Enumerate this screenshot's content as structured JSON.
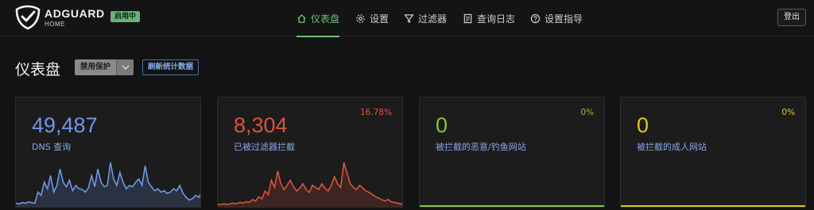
{
  "header": {
    "brand": "ADGUARD",
    "brand_sub": "HOME",
    "status_badge": "启用中",
    "nav": [
      {
        "label": "仪表盘",
        "icon": "home-icon"
      },
      {
        "label": "设置",
        "icon": "gear-icon"
      },
      {
        "label": "过滤器",
        "icon": "filter-icon"
      },
      {
        "label": "查询日志",
        "icon": "document-icon"
      },
      {
        "label": "设置指导",
        "icon": "help-circle-icon"
      }
    ],
    "logout": "登出"
  },
  "page": {
    "title": "仪表盘",
    "disable_protection": "禁用保护",
    "refresh_stats": "刷新统计数据"
  },
  "cards": [
    {
      "value": "49,487",
      "label": "DNS 查询",
      "percent": "",
      "color": "#6e96e8",
      "sparkline": [
        3,
        2,
        4,
        3,
        5,
        4,
        3,
        20,
        15,
        35,
        25,
        45,
        20,
        30,
        55,
        35,
        28,
        38,
        22,
        30,
        25,
        24,
        20,
        26,
        45,
        28,
        55,
        35,
        28,
        30,
        65,
        40,
        30,
        50,
        35,
        25,
        30,
        28,
        35,
        40,
        30,
        60,
        35,
        28,
        22,
        25,
        20,
        22,
        18,
        20,
        25,
        22,
        30,
        18,
        12,
        8,
        10,
        15,
        12,
        20
      ]
    },
    {
      "value": "8,304",
      "label": "已被过滤器拦截",
      "percent": "16.78%",
      "color": "#d9533e",
      "sparkline": [
        1,
        1,
        2,
        1,
        2,
        3,
        2,
        4,
        3,
        5,
        4,
        8,
        6,
        12,
        9,
        20,
        15,
        35,
        25,
        48,
        30,
        22,
        28,
        35,
        26,
        20,
        24,
        30,
        22,
        18,
        28,
        25,
        22,
        30,
        24,
        20,
        28,
        40,
        30,
        25,
        60,
        45,
        30,
        25,
        22,
        28,
        24,
        20,
        18,
        15,
        12,
        10,
        8,
        6,
        8,
        5,
        4,
        3,
        2,
        1
      ]
    },
    {
      "value": "0",
      "label": "被拦截的恶意/钓鱼网站",
      "percent": "0%",
      "color": "#8ac23a",
      "sparkline": []
    },
    {
      "value": "0",
      "label": "被拦截的成人网站",
      "percent": "0%",
      "color": "#ddc624",
      "sparkline": []
    }
  ]
}
